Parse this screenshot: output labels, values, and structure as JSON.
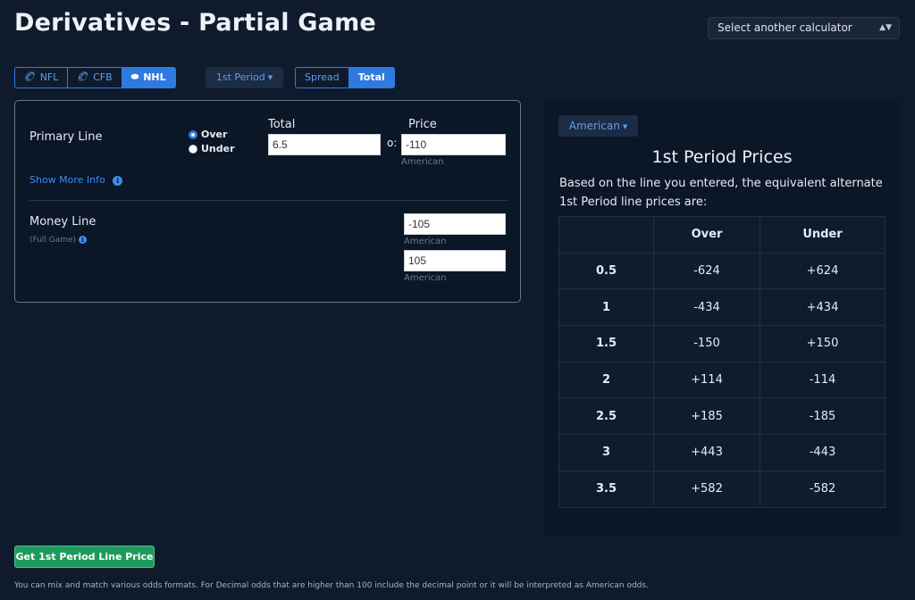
{
  "page": {
    "title": "Derivatives - Partial Game",
    "calculator_select": "Select another calculator"
  },
  "sports": [
    {
      "label": "NFL",
      "icon": "football-icon",
      "active": false
    },
    {
      "label": "CFB",
      "icon": "football-icon",
      "active": false
    },
    {
      "label": "NHL",
      "icon": "puck-icon",
      "active": true
    }
  ],
  "period_dropdown": "1st Period",
  "bet_types": [
    {
      "label": "Spread",
      "active": false
    },
    {
      "label": "Total",
      "active": true
    }
  ],
  "input": {
    "primary_line_label": "Primary Line",
    "over_label": "Over",
    "under_label": "Under",
    "selected": "Over",
    "total_header": "Total",
    "price_header": "Price",
    "total_value": "6.5",
    "price_prefix": "o:",
    "price_value": "-110",
    "price_format": "American",
    "show_more": "Show More Info",
    "money_line_label": "Money Line",
    "money_line_sub": "(Full Game)",
    "money_line_1": "-105",
    "money_line_1_format": "American",
    "money_line_2": "105",
    "money_line_2_format": "American"
  },
  "result": {
    "format_dropdown": "American",
    "title": "1st Period Prices",
    "description": "Based on the line you entered, the equivalent alternate 1st Period line prices are:",
    "columns": [
      "",
      "Over",
      "Under"
    ],
    "rows": [
      [
        "0.5",
        "-624",
        "+624"
      ],
      [
        "1",
        "-434",
        "+434"
      ],
      [
        "1.5",
        "-150",
        "+150"
      ],
      [
        "2",
        "+114",
        "-114"
      ],
      [
        "2.5",
        "+185",
        "-185"
      ],
      [
        "3",
        "+443",
        "-443"
      ],
      [
        "3.5",
        "+582",
        "-582"
      ]
    ]
  },
  "submit_label": "Get 1st Period Line Price",
  "footnote": "You can mix and match various odds formats. For Decimal odds that are higher than 100 include the decimal point or it will be interpreted as American odds.",
  "colors": {
    "background": "#0f1b2d",
    "accent": "#2f7ae0",
    "submit": "#1e9a5c"
  }
}
